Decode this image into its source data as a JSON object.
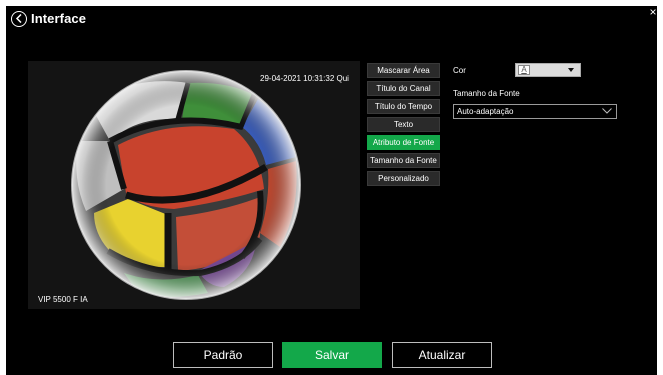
{
  "window": {
    "title": "Interface",
    "close_symbol": "×"
  },
  "preview": {
    "osd_time": "29-04-2021 10:31:32 Qui",
    "osd_name": "VIP 5500 F IA"
  },
  "menu": {
    "items": [
      {
        "label": "Mascarar Área",
        "active": false
      },
      {
        "label": "Título do Canal",
        "active": false
      },
      {
        "label": "Título do Tempo",
        "active": false
      },
      {
        "label": "Texto",
        "active": false
      },
      {
        "label": "Atributo de Fonte",
        "active": true
      },
      {
        "label": "Tamanho da Fonte",
        "active": false
      },
      {
        "label": "Personalizado",
        "active": false
      }
    ]
  },
  "props": {
    "cor_label": "Cor",
    "swatch_glyph": "A",
    "swatch_color": "#ffffff",
    "tamanho_label": "Tamanho da Fonte",
    "tamanho_value": "Auto-adaptação"
  },
  "footer": {
    "padrao_label": "Padrão",
    "salvar_label": "Salvar",
    "atualizar_label": "Atualizar"
  },
  "colors": {
    "accent": "#13a84a",
    "background": "#000000"
  },
  "icons": {
    "back": "back-circle-icon",
    "close": "close-icon",
    "dropdown": "chevron-down-icon"
  }
}
